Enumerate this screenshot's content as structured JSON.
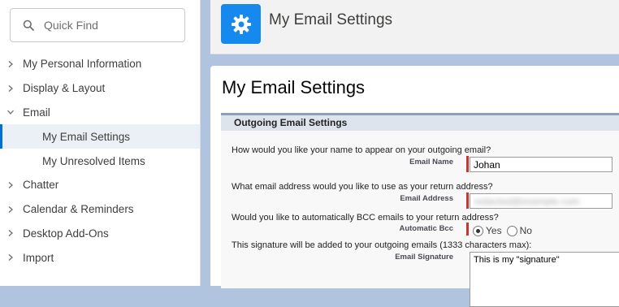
{
  "quick_find": {
    "placeholder": "Quick Find",
    "icon": "search-icon"
  },
  "sidebar": {
    "items": [
      {
        "label": "My Personal Information"
      },
      {
        "label": "Display & Layout"
      },
      {
        "label": "Email"
      },
      {
        "label": "My Email Settings"
      },
      {
        "label": "My Unresolved Items"
      },
      {
        "label": "Chatter"
      },
      {
        "label": "Calendar & Reminders"
      },
      {
        "label": "Desktop Add-Ons"
      },
      {
        "label": "Import"
      }
    ]
  },
  "header": {
    "title": "My Email Settings",
    "icon": "gear-icon"
  },
  "main": {
    "page_title": "My Email Settings",
    "section_title": "Outgoing Email Settings",
    "q_name": "How would you like your name to appear on your outgoing email?",
    "label_name": "Email Name",
    "value_name": "Johan",
    "q_address": "What email address would you like to use as your return address?",
    "label_address": "Email Address",
    "value_address": "redacted@example.com",
    "q_bcc": "Would you like to automatically BCC emails to your return address?",
    "label_bcc": "Automatic Bcc",
    "bcc_yes": "Yes",
    "bcc_no": "No",
    "q_signature": "This signature will be added to your outgoing emails (1333 characters max):",
    "label_signature": "Email Signature",
    "value_signature": "This is my \"signature\""
  },
  "colors": {
    "accent": "#0070d2",
    "badge": "#1589ee",
    "required": "#c23934",
    "backdrop": "#b0c4df"
  }
}
